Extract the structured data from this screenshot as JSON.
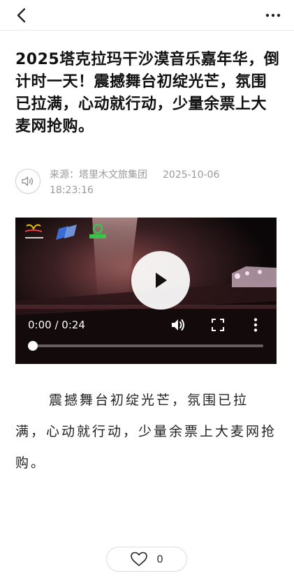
{
  "nav": {
    "back_icon": "chevron-left-icon",
    "more_icon": "more-dots-icon"
  },
  "article": {
    "title": "2025塔克拉玛干沙漠音乐嘉年华，倒计时一天！震撼舞台初绽光芒，氛围已拉满，心动就行动，少量余票上大麦网抢购。",
    "source_label": "来源：塔里木文旅集团",
    "date": "2025-10-06",
    "time": "18:23:16",
    "body": "震撼舞台初绽光芒，氛围已拉满，心动就行动，少量余票上大麦网抢购。"
  },
  "video": {
    "time_display": "0:00 / 0:24",
    "progress": 0.0
  },
  "like": {
    "count": "0",
    "icon": "heart-icon"
  },
  "colors": {
    "meta_gray": "#9a9a9a",
    "title": "#111111",
    "video_bg": "#000000"
  }
}
